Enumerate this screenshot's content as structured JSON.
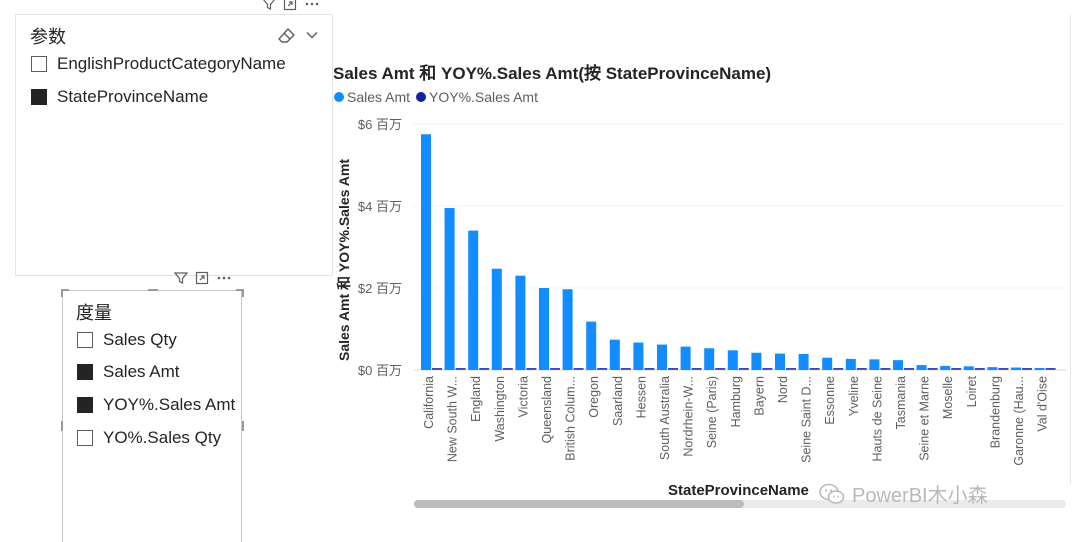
{
  "params_panel": {
    "title": "参数",
    "items": [
      {
        "label": "EnglishProductCategoryName",
        "checked": false
      },
      {
        "label": "StateProvinceName",
        "checked": true
      }
    ]
  },
  "measures_panel": {
    "title": "度量",
    "items": [
      {
        "label": "Sales Qty",
        "checked": false
      },
      {
        "label": "Sales Amt",
        "checked": true
      },
      {
        "label": "YOY%.Sales Amt",
        "checked": true
      },
      {
        "label": "YO%.Sales Qty",
        "checked": false
      }
    ]
  },
  "chart_data": {
    "type": "bar",
    "title": "Sales Amt 和 YOY%.Sales Amt(按 StateProvinceName)",
    "xlabel": "StateProvinceName",
    "ylabel": "Sales Amt 和 YOY%.Sales Amt",
    "legend_position": "top-left",
    "grid": true,
    "series": [
      {
        "name": "Sales Amt",
        "color": "#118dff",
        "values": [
          5.75,
          3.95,
          3.4,
          2.47,
          2.3,
          2.0,
          1.97,
          1.18,
          0.74,
          0.67,
          0.62,
          0.57,
          0.53,
          0.48,
          0.42,
          0.4,
          0.39,
          0.3,
          0.27,
          0.26,
          0.24,
          0.12,
          0.1,
          0.09,
          0.07,
          0.06,
          0.05
        ]
      },
      {
        "name": "YOY%.Sales Amt",
        "color": "#12239e",
        "values": [
          0.02,
          0.02,
          0.02,
          0.02,
          0.02,
          0.02,
          0.02,
          0.02,
          0.02,
          0.02,
          0.02,
          0.02,
          0.02,
          0.02,
          0.02,
          0.02,
          0.02,
          0.02,
          0.02,
          0.02,
          0.02,
          0.02,
          0.02,
          0.02,
          0.02,
          0.02,
          0.02
        ]
      }
    ],
    "categories": [
      "California",
      "New South W...",
      "England",
      "Washington",
      "Victoria",
      "Queensland",
      "British Colum...",
      "Oregon",
      "Saarland",
      "Hessen",
      "South Australia",
      "Nordrhein-W...",
      "Seine (Paris)",
      "Hamburg",
      "Bayern",
      "Nord",
      "Seine Saint D...",
      "Essonne",
      "Yveline",
      "Hauts de Seine",
      "Tasmania",
      "Seine et Marne",
      "Moselle",
      "Loiret",
      "Brandenburg",
      "Garonne (Hau...",
      "Val d'Oise"
    ],
    "ylim": [
      0,
      6
    ],
    "yticks": [
      {
        "value": 0,
        "label": "$0 百万"
      },
      {
        "value": 2,
        "label": "$2 百万"
      },
      {
        "value": 4,
        "label": "$4 百万"
      },
      {
        "value": 6,
        "label": "$6 百万"
      }
    ]
  },
  "watermark": "PowerBI木小森"
}
